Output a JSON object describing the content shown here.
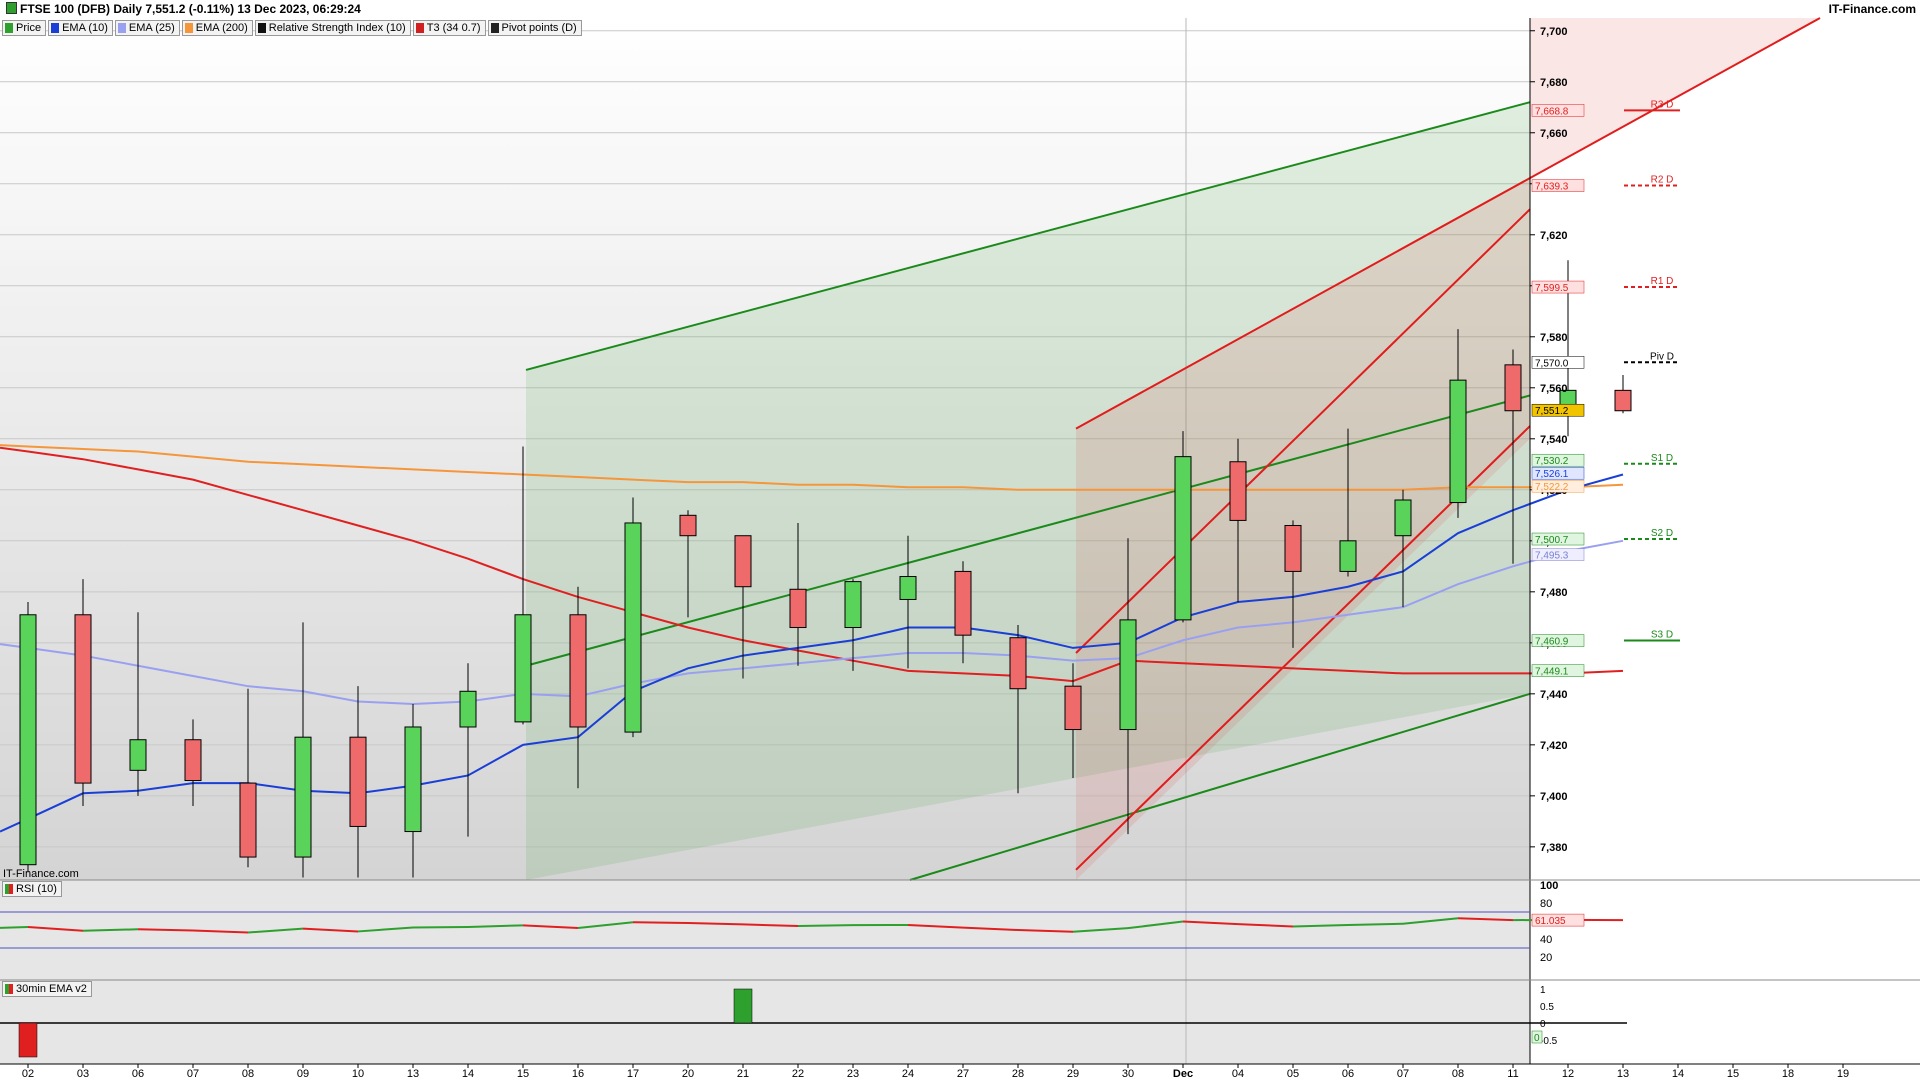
{
  "header": {
    "title": "FTSE 100 (DFB) Daily 7,551.2 (-0.11%) 13 Dec 2023, 06:29:24",
    "brand": "IT-Finance.com"
  },
  "legend": [
    {
      "label": "Price",
      "color": "#2ea02e"
    },
    {
      "label": "EMA (10)",
      "color": "#1a3fd6"
    },
    {
      "label": "EMA (25)",
      "color": "#9aa0f0"
    },
    {
      "label": "EMA (200)",
      "color": "#f5963a"
    },
    {
      "label": "Relative Strength Index (10)",
      "color": "#111111"
    },
    {
      "label": "T3 (34 0.7)",
      "color": "#d02020"
    },
    {
      "label": "Pivot points (D)",
      "color": "#222222"
    }
  ],
  "watermark": "IT-Finance.com",
  "rsi_panel": {
    "label": "RSI (10)",
    "value_label": "61.035",
    "ticks": [
      "100",
      "80",
      "60",
      "40",
      "20"
    ]
  },
  "ema_panel": {
    "label": "30min EMA v2",
    "ticks": [
      "1",
      "0.5",
      "0",
      "-0.5"
    ],
    "marker_0": "0"
  },
  "colors": {
    "up": "#5ad35a",
    "down": "#ef6b6b",
    "ema10": "#1a3fd6",
    "ema25": "#9aa0f0",
    "ema200": "#f5963a",
    "t3": "#e02020",
    "channel_green": "#1b8a1b",
    "channel_red": "#e01c1c",
    "rsi_line_green": "#2ea02e",
    "rsi_line_red": "#e02020",
    "band": "#5050c0",
    "price_tag": "#f2c400"
  },
  "chart_data": {
    "type": "candlestick",
    "x_labels": [
      "02",
      "03",
      "06",
      "07",
      "08",
      "09",
      "10",
      "13",
      "14",
      "15",
      "16",
      "17",
      "20",
      "21",
      "22",
      "23",
      "24",
      "27",
      "28",
      "29",
      "30",
      "Dec",
      "04",
      "05",
      "06",
      "07",
      "08",
      "11",
      "12",
      "13",
      "14",
      "15",
      "18",
      "19"
    ],
    "y_ticks": [
      "7,700",
      "7,680",
      "7,660",
      "7,640",
      "7,620",
      "7,600",
      "7,580",
      "7,560",
      "7,540",
      "7,520",
      "7,500",
      "7,480",
      "7,460",
      "7,440",
      "7,420",
      "7,400",
      "7,380"
    ],
    "ylim": [
      7367,
      7705
    ],
    "candles": [
      {
        "o": 7373,
        "h": 7476,
        "l": 7370,
        "c": 7471
      },
      {
        "o": 7471,
        "h": 7485,
        "l": 7396,
        "c": 7405
      },
      {
        "o": 7410,
        "h": 7472,
        "l": 7400,
        "c": 7422
      },
      {
        "o": 7422,
        "h": 7430,
        "l": 7396,
        "c": 7406
      },
      {
        "o": 7405,
        "h": 7442,
        "l": 7372,
        "c": 7376
      },
      {
        "o": 7376,
        "h": 7468,
        "l": 7368,
        "c": 7423
      },
      {
        "o": 7423,
        "h": 7443,
        "l": 7368,
        "c": 7388
      },
      {
        "o": 7386,
        "h": 7436,
        "l": 7368,
        "c": 7427
      },
      {
        "o": 7427,
        "h": 7452,
        "l": 7384,
        "c": 7441
      },
      {
        "o": 7429,
        "h": 7537,
        "l": 7428,
        "c": 7471
      },
      {
        "o": 7471,
        "h": 7482,
        "l": 7403,
        "c": 7427
      },
      {
        "o": 7425,
        "h": 7517,
        "l": 7423,
        "c": 7507
      },
      {
        "o": 7510,
        "h": 7512,
        "l": 7470,
        "c": 7502
      },
      {
        "o": 7502,
        "h": 7502,
        "l": 7446,
        "c": 7482
      },
      {
        "o": 7481,
        "h": 7507,
        "l": 7451,
        "c": 7466
      },
      {
        "o": 7466,
        "h": 7485,
        "l": 7449,
        "c": 7484
      },
      {
        "o": 7477,
        "h": 7502,
        "l": 7450,
        "c": 7486
      },
      {
        "o": 7488,
        "h": 7492,
        "l": 7452,
        "c": 7463
      },
      {
        "o": 7462,
        "h": 7467,
        "l": 7401,
        "c": 7442
      },
      {
        "o": 7443,
        "h": 7452,
        "l": 7407,
        "c": 7426
      },
      {
        "o": 7426,
        "h": 7501,
        "l": 7385,
        "c": 7469
      },
      {
        "o": 7469,
        "h": 7543,
        "l": 7468,
        "c": 7533
      },
      {
        "o": 7531,
        "h": 7540,
        "l": 7476,
        "c": 7508
      },
      {
        "o": 7506,
        "h": 7508,
        "l": 7458,
        "c": 7488
      },
      {
        "o": 7488,
        "h": 7544,
        "l": 7486,
        "c": 7500
      },
      {
        "o": 7502,
        "h": 7520,
        "l": 7474,
        "c": 7516
      },
      {
        "o": 7515,
        "h": 7583,
        "l": 7509,
        "c": 7563
      },
      {
        "o": 7569,
        "h": 7575,
        "l": 7491,
        "c": 7551
      },
      {
        "o": 7552,
        "h": 7610,
        "l": 7541,
        "c": 7559
      },
      {
        "o": 7559,
        "h": 7565,
        "l": 7550,
        "c": 7551
      }
    ],
    "ema10": [
      7391,
      7401,
      7402,
      7405,
      7405,
      7402,
      7401,
      7404,
      7408,
      7420,
      7423,
      7441,
      7450,
      7455,
      7458,
      7461,
      7466,
      7466,
      7463,
      7458,
      7460,
      7470,
      7476,
      7478,
      7482,
      7488,
      7503,
      7512,
      7520,
      7526
    ],
    "ema25": [
      7458,
      7455,
      7451,
      7447,
      7443,
      7441,
      7437,
      7436,
      7437,
      7440,
      7439,
      7444,
      7448,
      7450,
      7452,
      7454,
      7456,
      7456,
      7455,
      7453,
      7454,
      7461,
      7466,
      7468,
      7471,
      7474,
      7483,
      7490,
      7496,
      7500
    ],
    "ema200": [
      7537,
      7536,
      7535,
      7533,
      7531,
      7530,
      7529,
      7528,
      7527,
      7526,
      7525,
      7524,
      7523,
      7523,
      7522,
      7522,
      7521,
      7521,
      7520,
      7520,
      7520,
      7520,
      7520,
      7520,
      7520,
      7520,
      7521,
      7521,
      7521,
      7522
    ],
    "t3": [
      7535,
      7532,
      7528,
      7524,
      7518,
      7512,
      7506,
      7500,
      7493,
      7485,
      7478,
      7472,
      7466,
      7461,
      7457,
      7453,
      7449,
      7448,
      7447,
      7445,
      7453,
      7452,
      7451,
      7450,
      7449,
      7448,
      7448,
      7448,
      7448,
      7449
    ],
    "pivots": [
      {
        "label": "R3 D",
        "value": 7668.8
      },
      {
        "label": "R2 D",
        "value": 7639.3
      },
      {
        "label": "R1 D",
        "value": 7599.5
      },
      {
        "label": "Piv D",
        "value": 7570.0
      },
      {
        "label": "S1 D",
        "value": 7530.2
      },
      {
        "label": "S2 D",
        "value": 7500.7
      },
      {
        "label": "S3 D",
        "value": 7460.9
      }
    ],
    "price_tags": [
      "7,668.8",
      "7,639.3",
      "7,599.5",
      "7,570.0",
      "7,551.2",
      "7,530.2",
      "7,526.1",
      "7,522.2",
      "7,500.7",
      "7,495.3",
      "7,460.9",
      "7,449.1"
    ],
    "rsi": [
      53.4,
      49.2,
      50.8,
      49.4,
      47.2,
      51.5,
      48.4,
      52.8,
      53.4,
      55.2,
      52.2,
      58.6,
      57.8,
      56.2,
      54.5,
      55.4,
      55.6,
      52.6,
      50.0,
      48.0,
      52.1,
      59.4,
      56.5,
      53.9,
      55.5,
      57.0,
      63.1,
      61.0,
      61.2,
      61.0
    ],
    "rsi_bands": [
      70,
      30
    ],
    "ema_bars": [
      {
        "index": 0,
        "value": -1
      },
      {
        "index": 13,
        "value": 1
      }
    ]
  }
}
